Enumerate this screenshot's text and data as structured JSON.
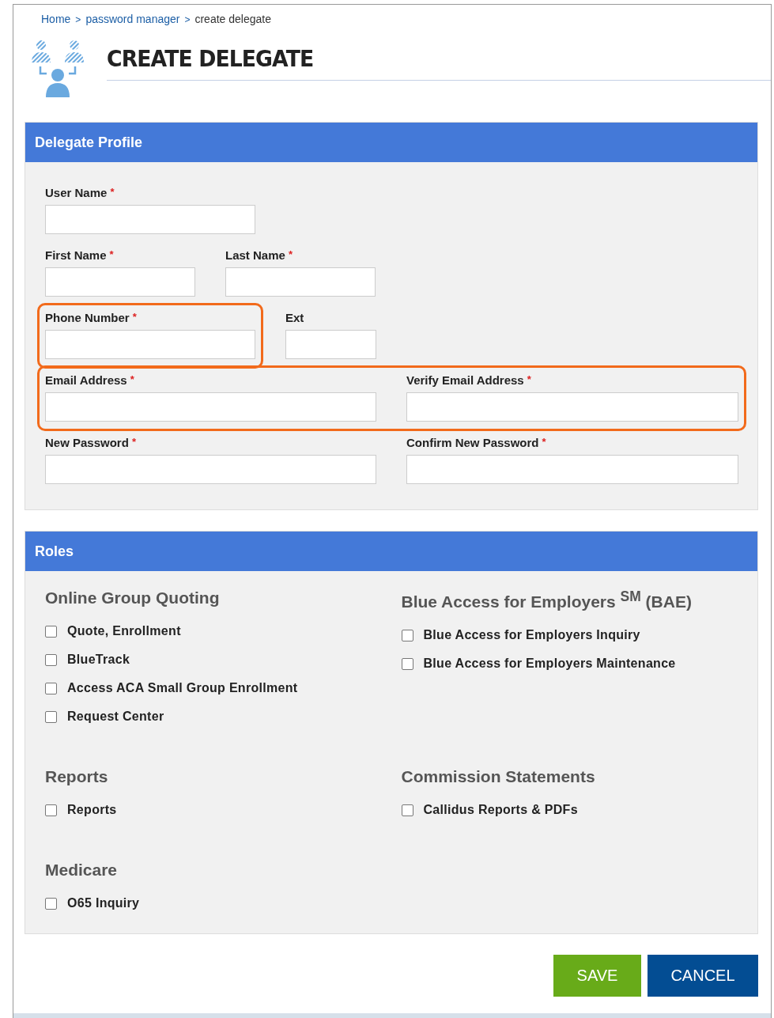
{
  "breadcrumb": [
    {
      "label": "Home",
      "link": true
    },
    {
      "separator": ">",
      "label": "password manager",
      "link": true
    },
    {
      "separator": ">",
      "label": "create delegate",
      "link": false
    }
  ],
  "page_title": "CREATE DELEGATE",
  "profile": {
    "heading": "Delegate Profile",
    "rows": [
      [
        {
          "label": "User Name",
          "required": true,
          "required_mark": "*",
          "highlighted": false
        }
      ],
      [
        {
          "label": "First Name",
          "required": true,
          "required_mark": "*",
          "highlighted": false
        },
        {
          "label": "Last Name",
          "required": true,
          "required_mark": "*",
          "highlighted": false
        }
      ],
      [
        {
          "label": "Phone Number",
          "required": true,
          "required_mark": "*",
          "highlighted": true
        },
        {
          "label": "Ext",
          "required": false,
          "highlighted": false
        }
      ],
      [
        {
          "label": "Email Address",
          "required": true,
          "required_mark": "*",
          "highlighted": true
        },
        {
          "label": "Verify Email Address",
          "required": true,
          "required_mark": "*",
          "highlighted": true
        }
      ],
      [
        {
          "label": "New Password",
          "required": true,
          "required_mark": "*",
          "highlighted": false
        },
        {
          "label": "Confirm New Password",
          "required": true,
          "required_mark": "*",
          "highlighted": false
        }
      ]
    ]
  },
  "roles": {
    "heading": "Roles",
    "sections": [
      [
        {
          "title": "Online Group Quoting",
          "items": [
            {
              "label": "Quote, Enrollment",
              "checked": false
            },
            {
              "label": "BlueTrack",
              "checked": false
            },
            {
              "label": "Access ACA Small Group Enrollment",
              "checked": false
            },
            {
              "label": "Request Center",
              "checked": false
            }
          ]
        },
        {
          "title": "Blue Access for Employers $^{SM}$ (BAE)",
          "items": [
            {
              "label": "Blue Access for Employers Inquiry",
              "checked": false
            },
            {
              "label": "Blue Access for Employers Maintenance",
              "checked": false
            }
          ]
        }
      ],
      [
        {
          "title": "Reports",
          "items": [
            {
              "label": "Reports",
              "checked": false
            }
          ]
        },
        {
          "title": "Commission Statements",
          "items": [
            {
              "label": "Callidus Reports & PDFs",
              "checked": false
            }
          ]
        }
      ],
      [
        {
          "title": "Medicare",
          "items": [
            {
              "label": "O65 Inquiry",
              "checked": false
            }
          ]
        }
      ]
    ]
  },
  "buttons": [
    {
      "label": "SAVE",
      "kind": "primary"
    },
    {
      "label": "CANCEL",
      "kind": "secondary"
    }
  ]
}
